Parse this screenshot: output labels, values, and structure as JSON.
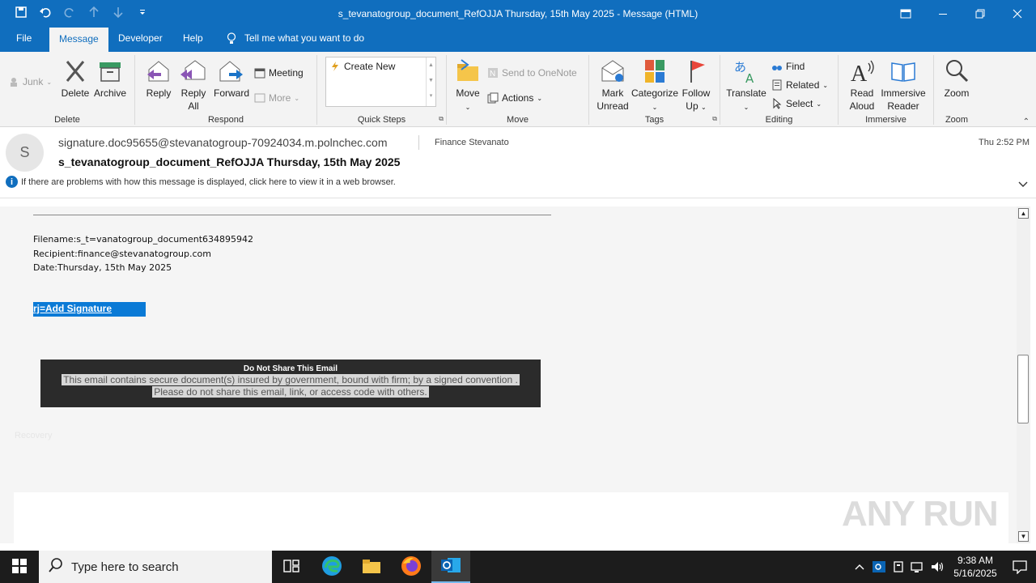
{
  "window": {
    "title": "s_tevanatogroup_document_RefOJJA Thursday, 15th May 2025  -  Message (HTML)"
  },
  "menu": {
    "tabs": [
      "File",
      "Message",
      "Developer",
      "Help"
    ],
    "tellme": "Tell me what you want to do"
  },
  "ribbon": {
    "delete_group": {
      "label": "Delete",
      "junk": "Junk",
      "delete": "Delete",
      "archive": "Archive"
    },
    "respond_group": {
      "label": "Respond",
      "reply": "Reply",
      "reply_all_1": "Reply",
      "reply_all_2": "All",
      "forward": "Forward",
      "meeting": "Meeting",
      "more": "More"
    },
    "quicksteps_group": {
      "label": "Quick Steps",
      "create_new": "Create New"
    },
    "move_group": {
      "label": "Move",
      "move": "Move",
      "onenote": "Send to OneNote",
      "actions": "Actions"
    },
    "tags_group": {
      "label": "Tags",
      "mark_1": "Mark",
      "mark_2": "Unread",
      "categorize": "Categorize",
      "follow_1": "Follow",
      "follow_2": "Up"
    },
    "editing_group": {
      "label": "Editing",
      "translate": "Translate",
      "find": "Find",
      "related": "Related",
      "select": "Select"
    },
    "immersive_group": {
      "label": "Immersive",
      "read_1": "Read",
      "read_2": "Aloud",
      "immersive_1": "Immersive",
      "immersive_2": "Reader"
    },
    "zoom_group": {
      "label": "Zoom",
      "zoom": "Zoom"
    }
  },
  "message": {
    "avatar_initial": "S",
    "sender": "signature.doc95655@stevanatogroup-70924034.m.polnchec.com",
    "to": "Finance Stevanato",
    "time": "Thu 2:52 PM",
    "subject": "s_tevanatogroup_document_RefOJJA Thursday, 15th May 2025",
    "info_bar": "If there are problems with how this message is displayed, click here to view it in a web browser."
  },
  "body": {
    "filename": "Filename:s_t=vanatogroup_document634895942",
    "recipient": "Recipient:finance@stevanatogroup.com",
    "date": "Date:Thursday, 15th May 2025",
    "signature_link": "rj=Add Signature",
    "notice_title": "Do Not Share This Email",
    "notice_line1": "This email contains secure document(s) insured by government, bound with firm; by a signed convention .",
    "notice_line2": "Please do not share this email, link, or access code with others.",
    "faded_text": "Recovery"
  },
  "watermark": "ANY RUN",
  "taskbar": {
    "search_placeholder": "Type here to search",
    "time": "9:38 AM",
    "date": "5/16/2025"
  },
  "colors": {
    "accent": "#106ebe",
    "link_highlight": "#0a7ad6",
    "notice_bg": "#2b2b2b"
  }
}
